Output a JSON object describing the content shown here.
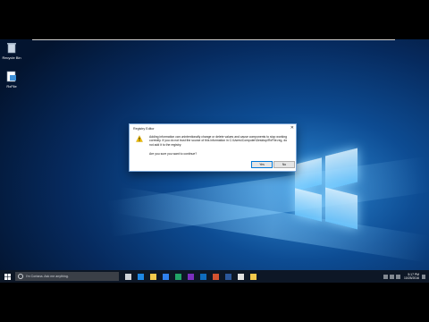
{
  "desktop": {
    "icons": [
      {
        "label": "Recycle Bin"
      },
      {
        "label": "RxFile"
      }
    ]
  },
  "dialog": {
    "title": "Registry Editor",
    "close_glyph": "✕",
    "message": "Adding information can unintentionally change or delete values and cause components to stop working correctly. If you do not trust the source of this information in C:\\Users\\Computer\\Desktop\\RxFile.reg, do not add it to the registry.",
    "question": "Are you sure you want to continue?",
    "yes_label": "Yes",
    "no_label": "No",
    "icon": "warning-icon"
  },
  "taskbar": {
    "search_placeholder": "I'm Cortana. Ask me anything.",
    "apps": [
      {
        "icon": "task-view-icon",
        "color": "#cfd3d8"
      },
      {
        "icon": "edge-icon",
        "color": "#1e88e5"
      },
      {
        "icon": "file-explorer-icon",
        "color": "#f2c94c"
      },
      {
        "icon": "store-icon",
        "color": "#2f80ed"
      },
      {
        "icon": "excel-icon",
        "color": "#21a366"
      },
      {
        "icon": "onenote-icon",
        "color": "#7b2fbf"
      },
      {
        "icon": "outlook-icon",
        "color": "#0f6cbd"
      },
      {
        "icon": "powerpoint-icon",
        "color": "#d35230"
      },
      {
        "icon": "word-icon",
        "color": "#2b579a"
      },
      {
        "icon": "app-icon",
        "color": "#e0e0e0"
      },
      {
        "icon": "registry-warning-icon",
        "color": "#f2c94c"
      }
    ],
    "time": "5:17 PM",
    "date": "10/25/2016"
  }
}
